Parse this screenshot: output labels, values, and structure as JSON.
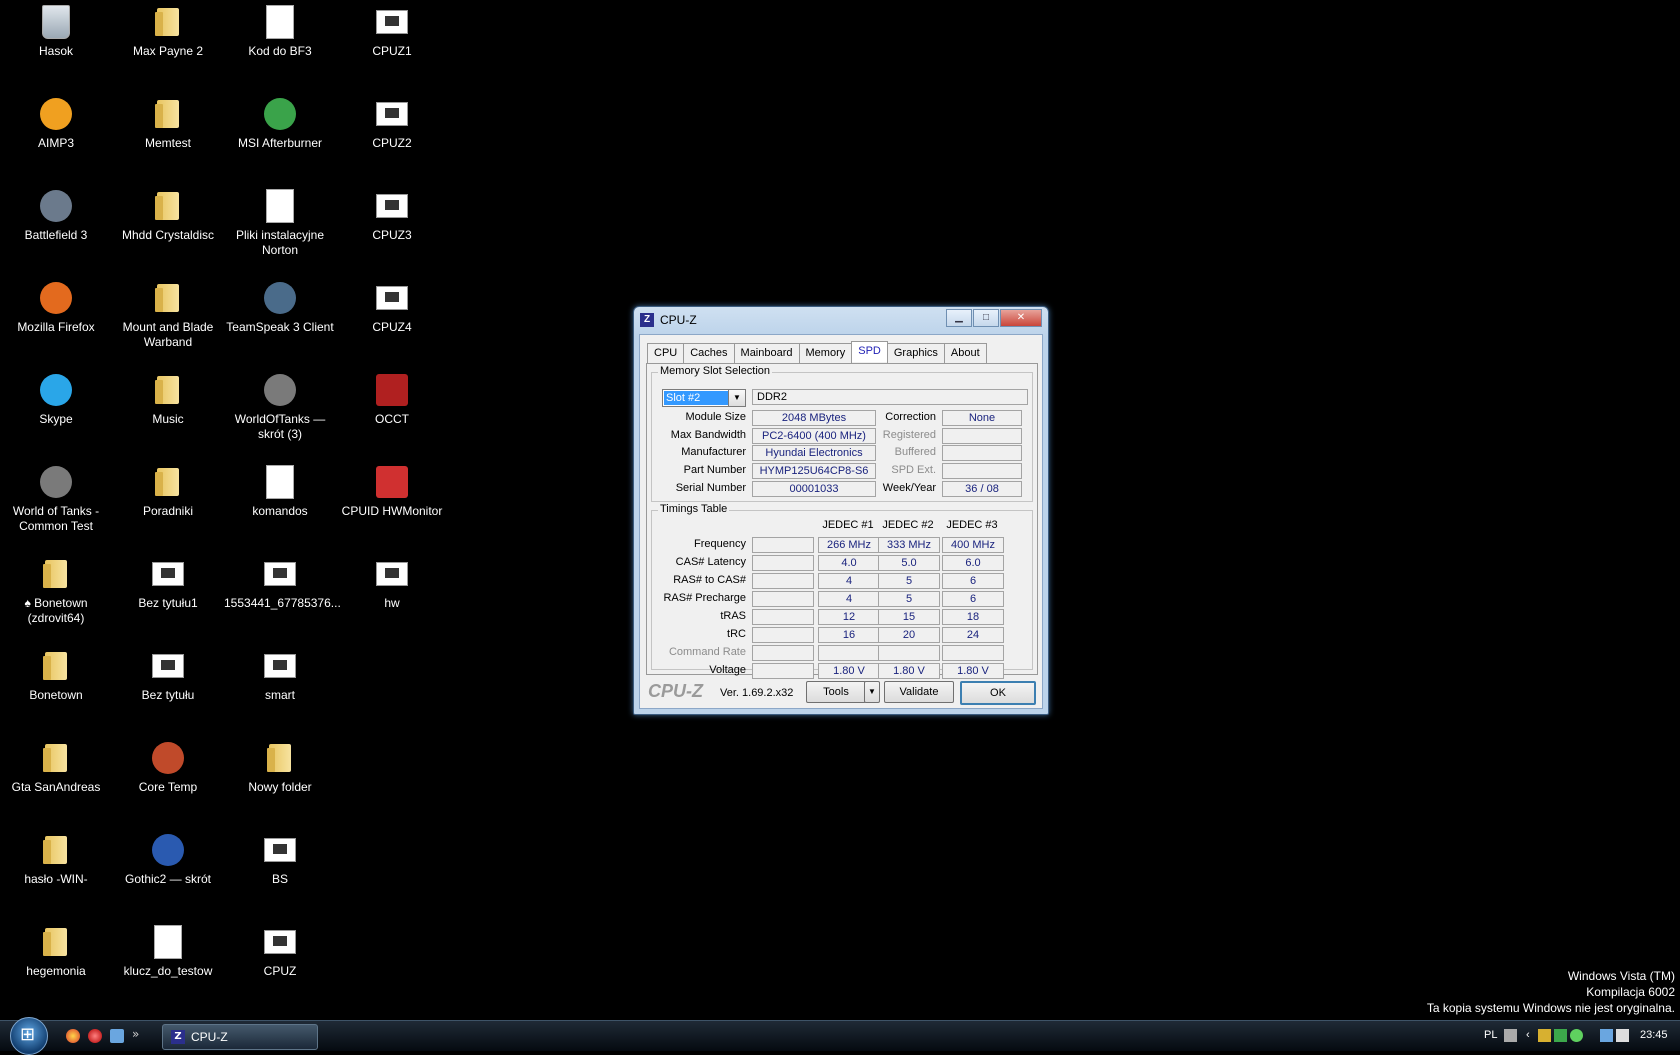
{
  "desktop": {
    "icons": [
      {
        "label": "Hasok",
        "icon": "recycle-bin-icon"
      },
      {
        "label": "AIMP3",
        "icon": "aimp-icon"
      },
      {
        "label": "Battlefield 3",
        "icon": "battlefield-icon"
      },
      {
        "label": "Mozilla Firefox",
        "icon": "firefox-icon"
      },
      {
        "label": "Skype",
        "icon": "skype-icon"
      },
      {
        "label": "World of Tanks - Common Test",
        "icon": "wot-icon"
      },
      {
        "label": "♠ Bonetown (zdrovit64)",
        "icon": "folder-icon"
      },
      {
        "label": "Bonetown",
        "icon": "folder-icon"
      },
      {
        "label": "Gta SanAndreas",
        "icon": "folder-icon"
      },
      {
        "label": "hasło -WIN-",
        "icon": "folder-icon"
      },
      {
        "label": "hegemonia",
        "icon": "folder-icon"
      },
      {
        "label": "Max Payne 2",
        "icon": "folder-icon"
      },
      {
        "label": "Memtest",
        "icon": "folder-icon"
      },
      {
        "label": "Mhdd Crystaldisc",
        "icon": "folder-icon"
      },
      {
        "label": "Mount and Blade Warband",
        "icon": "folder-icon"
      },
      {
        "label": "Music",
        "icon": "folder-icon"
      },
      {
        "label": "Poradniki",
        "icon": "folder-icon"
      },
      {
        "label": "Bez tytułu1",
        "icon": "image-icon"
      },
      {
        "label": "Bez tytułu",
        "icon": "image-icon"
      },
      {
        "label": "Core Temp",
        "icon": "coretemp-icon"
      },
      {
        "label": "Gothic2 — skrót",
        "icon": "gothic-icon"
      },
      {
        "label": "klucz_do_testow",
        "icon": "document-icon"
      },
      {
        "label": "Kod do BF3",
        "icon": "word-document-icon"
      },
      {
        "label": "MSI Afterburner",
        "icon": "afterburner-icon"
      },
      {
        "label": "Pliki instalacyjne Norton",
        "icon": "norton-icon"
      },
      {
        "label": "TeamSpeak 3 Client",
        "icon": "teamspeak-icon"
      },
      {
        "label": "WorldOfTanks — skrót (3)",
        "icon": "wot-icon"
      },
      {
        "label": "komandos",
        "icon": "document-icon"
      },
      {
        "label": "1553441_67785376...",
        "icon": "image-icon"
      },
      {
        "label": "smart",
        "icon": "image-icon"
      },
      {
        "label": "Nowy folder",
        "icon": "folder-icon"
      },
      {
        "label": "BS",
        "icon": "image-icon"
      },
      {
        "label": "CPUZ",
        "icon": "image-icon"
      },
      {
        "label": "CPUZ1",
        "icon": "image-icon"
      },
      {
        "label": "CPUZ2",
        "icon": "image-icon"
      },
      {
        "label": "CPUZ3",
        "icon": "image-icon"
      },
      {
        "label": "CPUZ4",
        "icon": "image-icon"
      },
      {
        "label": "OCCT",
        "icon": "occt-icon"
      },
      {
        "label": "CPUID HWMonitor",
        "icon": "hwmonitor-icon"
      },
      {
        "label": "hw",
        "icon": "image-icon"
      }
    ]
  },
  "cpuz": {
    "title": "CPU-Z",
    "tabs": [
      "CPU",
      "Caches",
      "Mainboard",
      "Memory",
      "SPD",
      "Graphics",
      "About"
    ],
    "active_tab": "SPD",
    "slot_group": "Memory Slot Selection",
    "slot_selected": "Slot #2",
    "mem_type": "DDR2",
    "labels": {
      "module_size": "Module Size",
      "max_bandwidth": "Max Bandwidth",
      "manufacturer": "Manufacturer",
      "part_number": "Part Number",
      "serial_number": "Serial Number",
      "correction": "Correction",
      "registered": "Registered",
      "buffered": "Buffered",
      "spd_ext": "SPD Ext.",
      "week_year": "Week/Year"
    },
    "values": {
      "module_size": "2048 MBytes",
      "max_bandwidth": "PC2-6400 (400 MHz)",
      "manufacturer": "Hyundai Electronics",
      "part_number": "HYMP125U64CP8-S6",
      "serial_number": "00001033",
      "correction": "None",
      "week_year": "36 / 08"
    },
    "timings_group": "Timings Table",
    "timing_cols": [
      "JEDEC #1",
      "JEDEC #2",
      "JEDEC #3"
    ],
    "timing_rows": [
      {
        "label": "Frequency",
        "values": [
          "266 MHz",
          "333 MHz",
          "400 MHz"
        ]
      },
      {
        "label": "CAS# Latency",
        "values": [
          "4.0",
          "5.0",
          "6.0"
        ]
      },
      {
        "label": "RAS# to CAS#",
        "values": [
          "4",
          "5",
          "6"
        ]
      },
      {
        "label": "RAS# Precharge",
        "values": [
          "4",
          "5",
          "6"
        ]
      },
      {
        "label": "tRAS",
        "values": [
          "12",
          "15",
          "18"
        ]
      },
      {
        "label": "tRC",
        "values": [
          "16",
          "20",
          "24"
        ]
      },
      {
        "label": "Command Rate",
        "values": [
          "",
          "",
          ""
        ]
      },
      {
        "label": "Voltage",
        "values": [
          "1.80 V",
          "1.80 V",
          "1.80 V"
        ]
      }
    ],
    "brand": "CPU-Z",
    "version": "Ver. 1.69.2.x32",
    "buttons": {
      "tools": "Tools",
      "validate": "Validate",
      "ok": "OK"
    }
  },
  "taskbar": {
    "task_label": "CPU-Z",
    "language": "PL",
    "clock": "23:45"
  },
  "watermark": {
    "line1": "Windows Vista (TM)",
    "line2": "Kompilacja 6002",
    "line3": "Ta kopia systemu Windows nie jest oryginalna."
  }
}
